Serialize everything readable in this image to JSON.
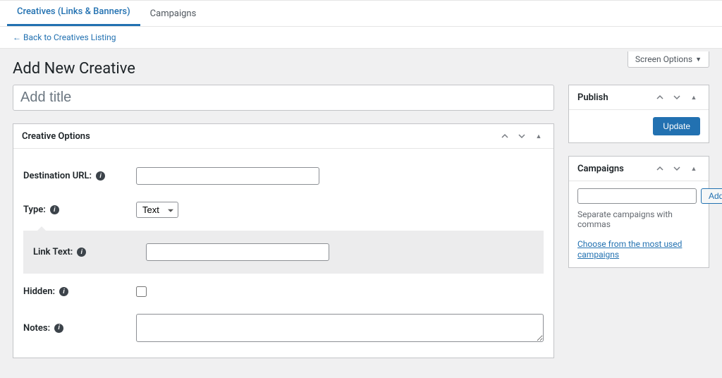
{
  "tabs": {
    "creatives": "Creatives (Links & Banners)",
    "campaigns": "Campaigns"
  },
  "back_link": "← Back to Creatives Listing",
  "screen_options": "Screen Options",
  "page_title": "Add New Creative",
  "title_placeholder": "Add title",
  "creative_options": {
    "heading": "Creative Options",
    "destination_url_label": "Destination URL:",
    "type_label": "Type:",
    "type_value": "Text",
    "link_text_label": "Link Text:",
    "hidden_label": "Hidden:",
    "notes_label": "Notes:"
  },
  "publish": {
    "heading": "Publish",
    "update_button": "Update"
  },
  "campaigns": {
    "heading": "Campaigns",
    "add_button": "Add",
    "hint": "Separate campaigns with commas",
    "choose_link": "Choose from the most used campaigns"
  },
  "icons": {
    "info": "i",
    "triangle_down": "▼",
    "triangle_up": "▲"
  }
}
